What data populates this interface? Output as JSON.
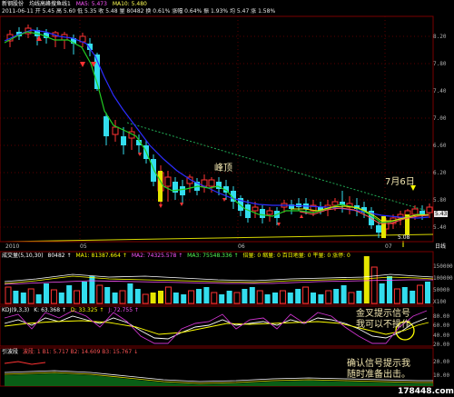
{
  "header": {
    "stock_name": "新钢股份",
    "indicator": "均线高峰搜鱼线1",
    "ma5": "MA5: 5.473",
    "ma10": "MA10: 5.480",
    "top_row2": "2011-06-11  开 5.45  高 5.60  低 5.35  收 5.48  量 80482  换 0.61%  涨幅 0.64%  振 1.93%  均 5.47  涨 1.58%",
    "right_label": "5.43"
  },
  "price_axis": [
    "8.20",
    "7.80",
    "7.40",
    "7.00",
    "6.60",
    "6.20",
    "5.80",
    "5.40"
  ],
  "x_axis": {
    "labels": [
      "2010",
      "05",
      "06",
      "07"
    ],
    "right": "日线"
  },
  "annotations": {
    "peak": "峰顶",
    "date": "7月6日",
    "golden_cross": "金叉提示信号\n我可以不操作",
    "confirm": "确认信号提示我\n随时准备出击。",
    "low_label": "5.08"
  },
  "volume": {
    "title": "成交量(5,10,30)",
    "v1": "80482 ↑",
    "ma1": "MA1: 81387.664 ↑",
    "ma2": "MA2: 74325.578 ↑",
    "ma3": "MA3: 75548.336 ↑",
    "tags": "倍量: 0  缩量: 0  百日地量: 0  平量: 0  涨停: 0",
    "axis": [
      "150000",
      "100000",
      "50000",
      "X100"
    ]
  },
  "kdj": {
    "title": "KDJ(9,3,3)",
    "k": "K: 63.368 ↑",
    "d": "D: 33.325 ↑",
    "j": "J: 72.755 ↑",
    "axis": [
      "80.00",
      "60.00",
      "40.00",
      "20.00"
    ]
  },
  "sub": {
    "title": "引波段",
    "vals": "波段: 1  B1: 5.717  B2: 14.609  B3: 15.767 ↓",
    "axis": [
      "20.00",
      "10.00"
    ]
  },
  "watermark": "178448.com",
  "colors": {
    "up": "#ff3333",
    "down": "#33ddee",
    "ma_blue": "#2d2dff",
    "ma_green": "#22cc22",
    "ma_yellow": "#e6e600",
    "grid": "#7a0000"
  }
}
